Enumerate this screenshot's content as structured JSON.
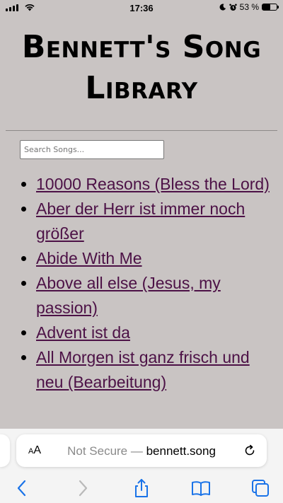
{
  "status": {
    "time": "17:36",
    "battery_percent_label": "53 %",
    "battery_level": 0.53
  },
  "page": {
    "title": "Bennett's Song Library",
    "search_placeholder": "Search Songs..."
  },
  "songs": [
    "10000 Reasons (Bless the Lord)",
    "Aber der Herr ist immer noch größer",
    "Abide With Me",
    "Above all else (Jesus, my passion)",
    "Advent ist da",
    "All Morgen ist ganz frisch und neu (Bearbeitung)"
  ],
  "browser": {
    "text_size_label_small": "A",
    "text_size_label_large": "A",
    "security_label": "Not Secure —",
    "domain": "bennett.song"
  },
  "colors": {
    "page_background": "#c9c4c3",
    "link": "#4c1146",
    "toolbar_icon": "#1a73e8"
  },
  "icons": {
    "signal": "cellular-signal-icon",
    "wifi": "wifi-icon",
    "do_not_disturb": "moon-icon",
    "alarm": "alarm-icon",
    "battery": "battery-icon",
    "reload": "reload-icon",
    "back": "chevron-left-icon",
    "forward": "chevron-right-icon",
    "share": "share-icon",
    "bookmarks": "book-icon",
    "tabs": "tabs-icon"
  }
}
